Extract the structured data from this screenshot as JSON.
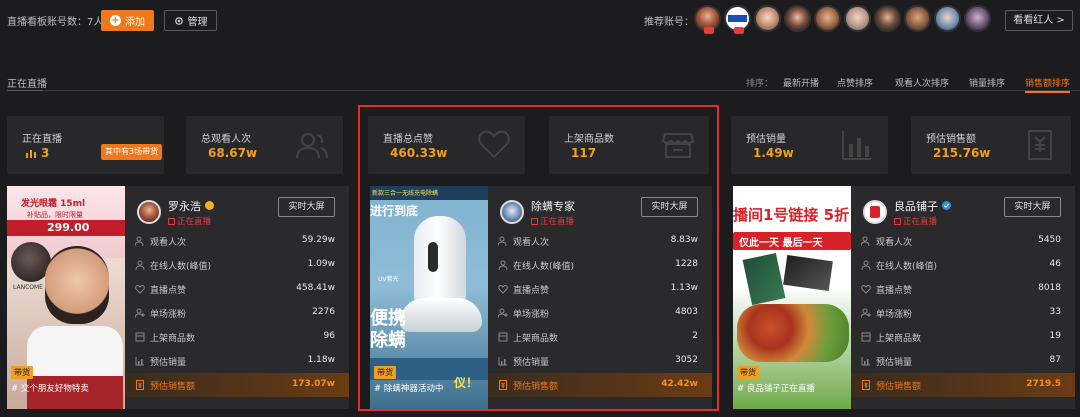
{
  "topbar": {
    "account_count": "直播看板账号数：7人",
    "add_label": "添加",
    "manage_label": "管理",
    "recommend_label": "推荐账号：",
    "watch_label": "看看红人 >"
  },
  "section": {
    "title": "正在直播",
    "sort_label": "排序：",
    "sort_options": [
      "最新开播",
      "点赞排序",
      "观看人次排序",
      "销量排序",
      "销售额排序"
    ],
    "active_sort": "销售额排序"
  },
  "stats": [
    {
      "label": "正在直播",
      "value": "3",
      "badge": "其中有3场带货",
      "icon": "bar-chart-icon"
    },
    {
      "label": "总观看人次",
      "value": "68.67w",
      "icon": "users-icon"
    },
    {
      "label": "直播总点赞",
      "value": "460.33w",
      "icon": "heart-icon"
    },
    {
      "label": "上架商品数",
      "value": "117",
      "icon": "store-icon"
    },
    {
      "label": "预估销量",
      "value": "1.49w",
      "icon": "bar-chart-icon"
    },
    {
      "label": "预估销售额",
      "value": "215.76w",
      "icon": "receipt-icon"
    }
  ],
  "cards": [
    {
      "host": "罗永浩",
      "status": "正在直播",
      "screen_label": "实时大屏",
      "tag": "带货",
      "caption": "# 交个朋友好物特卖",
      "cover_texts": [
        "发光眼霜 15ml",
        "补贴品，限时限量",
        "299.00",
        "LANCOME"
      ],
      "rows": [
        {
          "label": "观看人次",
          "value": "59.29w"
        },
        {
          "label": "在线人数(峰值)",
          "value": "1.09w"
        },
        {
          "label": "直播点赞",
          "value": "458.41w"
        },
        {
          "label": "单场涨粉",
          "value": "2276"
        },
        {
          "label": "上架商品数",
          "value": "96"
        },
        {
          "label": "预估销量",
          "value": "1.18w"
        },
        {
          "label": "预估销售额",
          "value": "173.07w"
        }
      ]
    },
    {
      "host": "除螨专家",
      "status": "正在直播",
      "screen_label": "实时大屏",
      "tag": "带货",
      "caption": "# 除螨神器活动中",
      "cover_texts": [
        "新款三合一无线充电除螨",
        "进行到底",
        "便携",
        "除螨",
        "UV紫光",
        "仪！"
      ],
      "rows": [
        {
          "label": "观看人次",
          "value": "8.83w"
        },
        {
          "label": "在线人数(峰值)",
          "value": "1228"
        },
        {
          "label": "直播点赞",
          "value": "1.13w"
        },
        {
          "label": "单场涨粉",
          "value": "4803"
        },
        {
          "label": "上架商品数",
          "value": "2"
        },
        {
          "label": "预估销量",
          "value": "3052"
        },
        {
          "label": "预估销售额",
          "value": "42.42w"
        }
      ]
    },
    {
      "host": "良品铺子",
      "status": "正在直播",
      "screen_label": "实时大屏",
      "tag": "带货",
      "caption": "# 良品铺子正在直播",
      "cover_texts": [
        "播间1号链接 5折",
        "仅此一天 最后一天"
      ],
      "rows": [
        {
          "label": "观看人次",
          "value": "5450"
        },
        {
          "label": "在线人数(峰值)",
          "value": "46"
        },
        {
          "label": "直播点赞",
          "value": "8018"
        },
        {
          "label": "单场涨粉",
          "value": "33"
        },
        {
          "label": "上架商品数",
          "value": "19"
        },
        {
          "label": "预估销量",
          "value": "87"
        },
        {
          "label": "预估销售额",
          "value": "2719.5"
        }
      ]
    }
  ],
  "colors": {
    "accent": "#f0771a",
    "value": "#f0a020",
    "live": "#e33c3c",
    "highlight_frame": "#e52c2c"
  }
}
